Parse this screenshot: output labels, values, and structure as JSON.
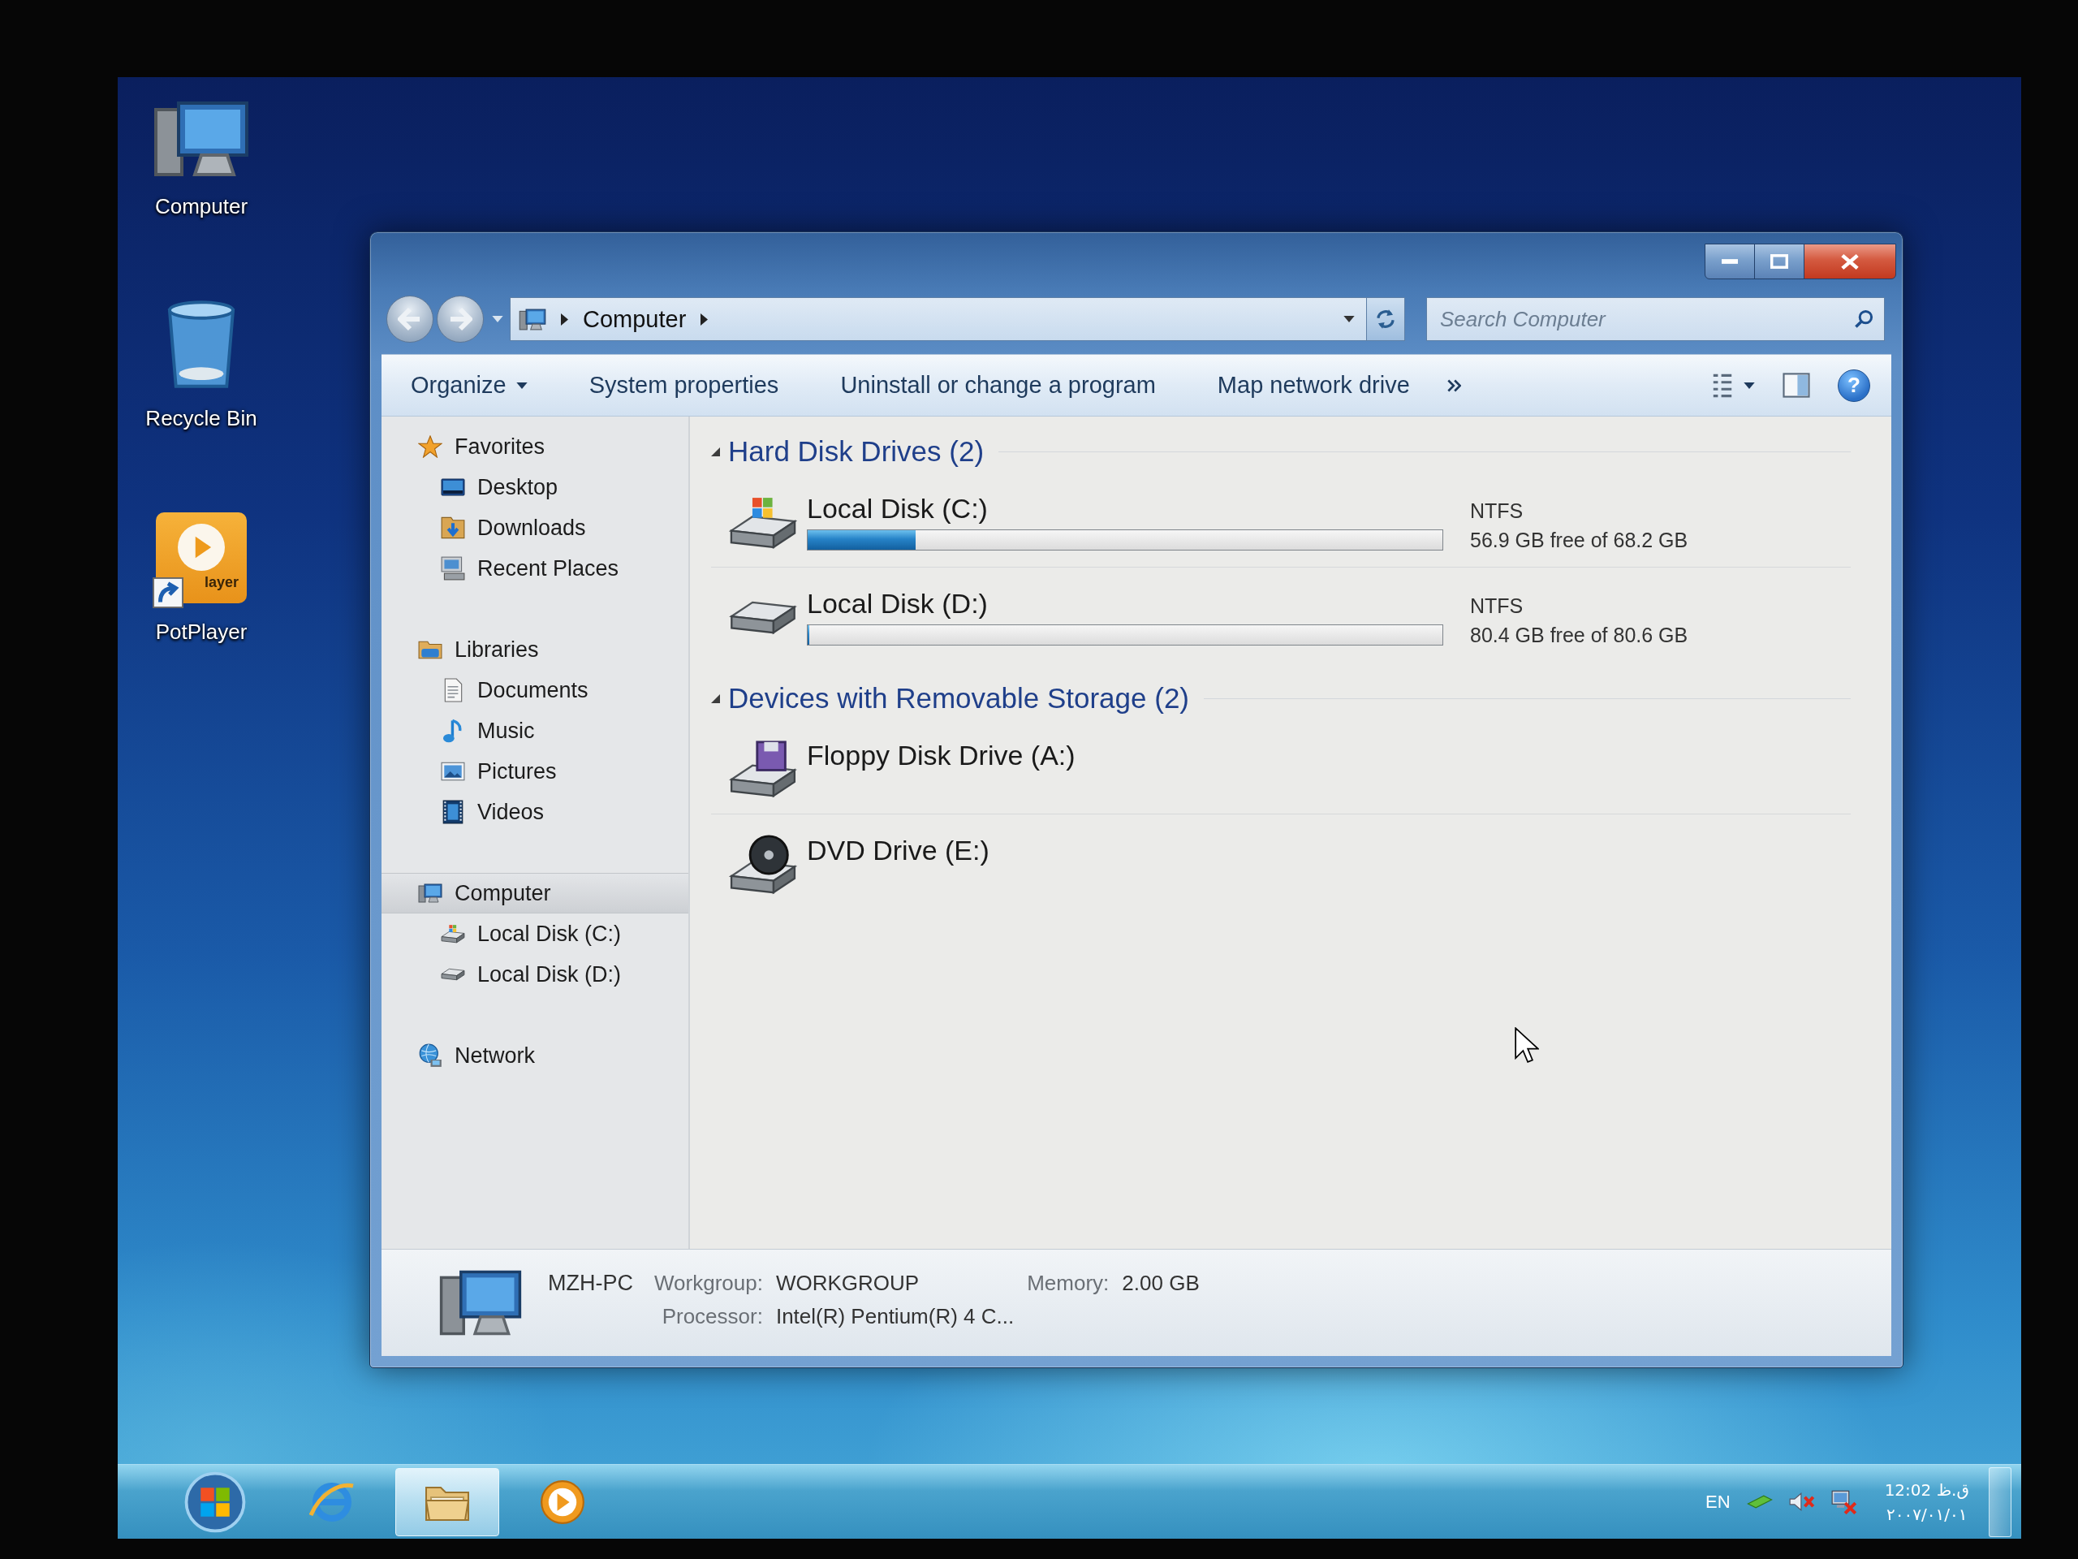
{
  "desktop": {
    "icons": [
      {
        "kind": "computer",
        "label": "Computer",
        "shortcut": false
      },
      {
        "kind": "recycle_bin",
        "label": "Recycle Bin",
        "shortcut": false
      },
      {
        "kind": "media_player",
        "label": "PotPlayer",
        "logo_text": "layer",
        "shortcut": true
      }
    ]
  },
  "window": {
    "nav_buttons": [
      {
        "kind": "back",
        "disabled": true
      },
      {
        "kind": "forward",
        "disabled": true
      }
    ],
    "address_bar": {
      "path": [
        "Computer"
      ]
    },
    "search": {
      "placeholder": "Search Computer"
    },
    "command_bar": {
      "items": [
        {
          "label": "Organize",
          "dropdown": true
        },
        {
          "label": "System properties",
          "dropdown": false
        },
        {
          "label": "Uninstall or change a program",
          "dropdown": false
        },
        {
          "label": "Map network drive",
          "dropdown": false
        }
      ],
      "help": "?"
    },
    "sidebar": {
      "items": [
        {
          "kind": "favorites",
          "label": "Favorites",
          "selected": false,
          "children": [
            {
              "kind": "desktop",
              "label": "Desktop",
              "selected": false
            },
            {
              "kind": "downloads",
              "label": "Downloads",
              "selected": false
            },
            {
              "kind": "recent",
              "label": "Recent Places",
              "selected": false
            }
          ]
        },
        {
          "kind": "libraries",
          "label": "Libraries",
          "selected": false,
          "children": [
            {
              "kind": "documents",
              "label": "Documents",
              "selected": false
            },
            {
              "kind": "music",
              "label": "Music",
              "selected": false
            },
            {
              "kind": "pictures",
              "label": "Pictures",
              "selected": false
            },
            {
              "kind": "videos",
              "label": "Videos",
              "selected": false
            }
          ]
        },
        {
          "kind": "computer",
          "label": "Computer",
          "selected": true,
          "children": [
            {
              "kind": "windows_disk",
              "label": "Local Disk (C:)",
              "selected": false
            },
            {
              "kind": "disk",
              "label": "Local Disk (D:)",
              "selected": false
            }
          ]
        },
        {
          "kind": "network",
          "label": "Network",
          "selected": false
        }
      ]
    },
    "sections": [
      {
        "title": "Hard Disk Drives (2)",
        "expanded": true,
        "items": [
          {
            "kind": "windows_disk",
            "name": "Local Disk (C:)",
            "filesystem": "NTFS",
            "level": 0.17,
            "space": "56.9 GB free of 68.2 GB"
          },
          {
            "kind": "disk",
            "name": "Local Disk (D:)",
            "filesystem": "NTFS",
            "level": 0.003,
            "space": "80.4 GB free of 80.6 GB"
          }
        ]
      },
      {
        "title": "Devices with Removable Storage (2)",
        "expanded": true,
        "items": [
          {
            "kind": "floppy",
            "name": "Floppy Disk Drive (A:)"
          },
          {
            "kind": "dvd",
            "name": "DVD Drive (E:)"
          }
        ]
      }
    ],
    "details": {
      "name": "MZH-PC",
      "fields": [
        {
          "label": "Workgroup:",
          "value": "WORKGROUP"
        },
        {
          "label": "Memory:",
          "value": "2.00 GB"
        },
        {
          "label": "Processor:",
          "value": "Intel(R) Pentium(R) 4 C..."
        }
      ]
    }
  },
  "taskbar": {
    "apps": [
      {
        "kind": "browser",
        "selected": false
      },
      {
        "kind": "explorer",
        "selected": true
      },
      {
        "kind": "media_player",
        "selected": false
      }
    ],
    "tray": {
      "language": "EN",
      "icons": [
        {
          "kind": "app"
        },
        {
          "kind": "volume_muted"
        },
        {
          "kind": "network_disconnected"
        }
      ],
      "time": "12:02 ق.ظ",
      "date": "۲۰۰۷/۰۱/۰۱"
    }
  }
}
